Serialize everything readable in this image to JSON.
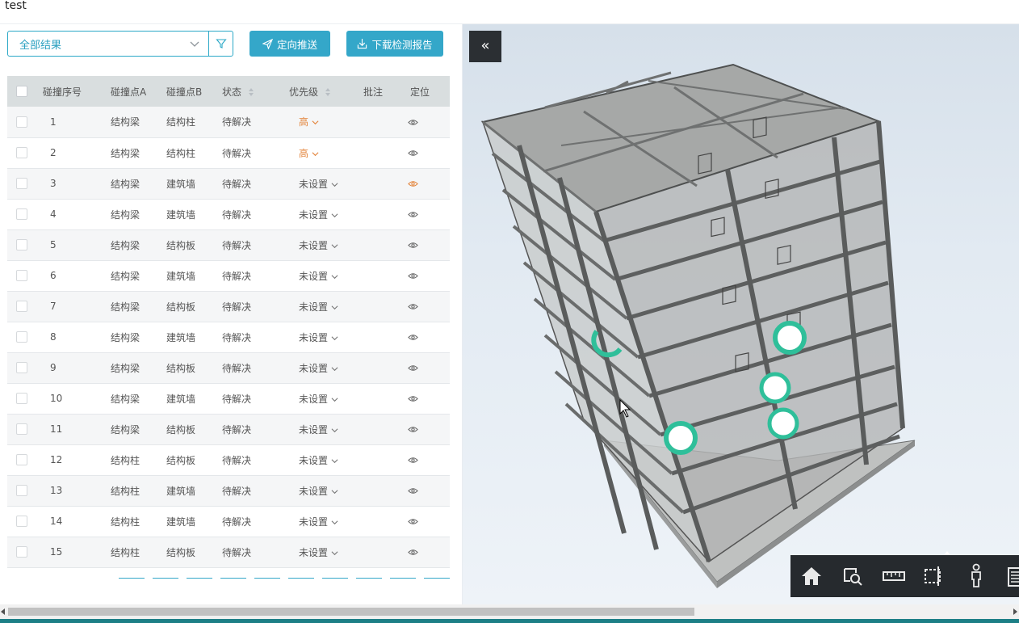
{
  "page": {
    "title": "test"
  },
  "toolbar": {
    "filter_value": "全部结果",
    "push_label": "定向推送",
    "download_label": "下载检测报告"
  },
  "table": {
    "headers": {
      "index": "碰撞序号",
      "point_a": "碰撞点A",
      "point_b": "碰撞点B",
      "status": "状态",
      "priority": "优先级",
      "note": "批注",
      "locate": "定位"
    },
    "rows": [
      {
        "index": "1",
        "a": "结构梁",
        "b": "结构柱",
        "status": "待解决",
        "priority": "高",
        "high": true
      },
      {
        "index": "2",
        "a": "结构梁",
        "b": "结构柱",
        "status": "待解决",
        "priority": "高",
        "high": true
      },
      {
        "index": "3",
        "a": "结构梁",
        "b": "建筑墙",
        "status": "待解决",
        "priority": "未设置",
        "high": false
      },
      {
        "index": "4",
        "a": "结构梁",
        "b": "建筑墙",
        "status": "待解决",
        "priority": "未设置",
        "high": false
      },
      {
        "index": "5",
        "a": "结构梁",
        "b": "结构板",
        "status": "待解决",
        "priority": "未设置",
        "high": false
      },
      {
        "index": "6",
        "a": "结构梁",
        "b": "建筑墙",
        "status": "待解决",
        "priority": "未设置",
        "high": false
      },
      {
        "index": "7",
        "a": "结构梁",
        "b": "结构板",
        "status": "待解决",
        "priority": "未设置",
        "high": false
      },
      {
        "index": "8",
        "a": "结构梁",
        "b": "建筑墙",
        "status": "待解决",
        "priority": "未设置",
        "high": false
      },
      {
        "index": "9",
        "a": "结构梁",
        "b": "结构板",
        "status": "待解决",
        "priority": "未设置",
        "high": false
      },
      {
        "index": "10",
        "a": "结构梁",
        "b": "建筑墙",
        "status": "待解决",
        "priority": "未设置",
        "high": false
      },
      {
        "index": "11",
        "a": "结构梁",
        "b": "结构板",
        "status": "待解决",
        "priority": "未设置",
        "high": false
      },
      {
        "index": "12",
        "a": "结构柱",
        "b": "结构板",
        "status": "待解决",
        "priority": "未设置",
        "high": false
      },
      {
        "index": "13",
        "a": "结构柱",
        "b": "建筑墙",
        "status": "待解决",
        "priority": "未设置",
        "high": false
      },
      {
        "index": "14",
        "a": "结构柱",
        "b": "建筑墙",
        "status": "待解决",
        "priority": "未设置",
        "high": false
      },
      {
        "index": "15",
        "a": "结构柱",
        "b": "结构板",
        "status": "待解决",
        "priority": "未设置",
        "high": false
      }
    ]
  },
  "viewer": {
    "collapse_icon": "double-chevron-left-icon",
    "tools": [
      "home-icon",
      "zoom-area-icon",
      "ruler-icon",
      "section-box-icon",
      "person-icon",
      "list-icon"
    ]
  },
  "colors": {
    "accent": "#34a7c9",
    "priority_high": "#e3843b",
    "marker": "#2fbf9a",
    "toolbar_bg": "#262a2e"
  }
}
